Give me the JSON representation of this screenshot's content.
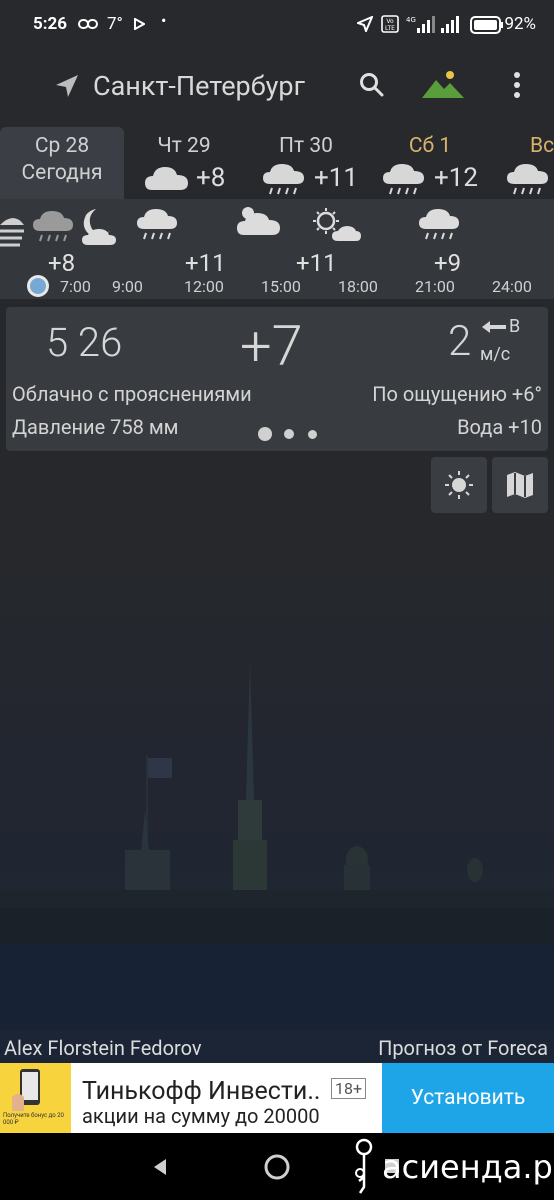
{
  "status_bar": {
    "time": "5:26",
    "temp": "7°",
    "battery": "92%"
  },
  "header": {
    "city": "Санкт-Петербург"
  },
  "days": [
    {
      "name": "Ср 28",
      "sub": "Сегодня",
      "temp": ""
    },
    {
      "name": "Чт 29",
      "sub": "",
      "temp": "+8"
    },
    {
      "name": "Пт 30",
      "sub": "",
      "temp": "+11"
    },
    {
      "name": "Сб 1",
      "sub": "",
      "temp": "+12"
    },
    {
      "name": "Вс",
      "sub": "",
      "temp": ""
    }
  ],
  "hourly": {
    "temps": [
      "+8",
      "+11",
      "+11",
      "+9"
    ],
    "times": [
      "7:00",
      "9:00",
      "12:00",
      "15:00",
      "18:00",
      "21:00",
      "24:00"
    ]
  },
  "current": {
    "time": "5 26",
    "temp": "+7",
    "wind_speed": "2",
    "wind_dir": "В",
    "wind_unit": "м/с",
    "condition": "Облачно с прояснениями",
    "feels_like": "По ощущению +6°",
    "pressure": "Давление 758 мм",
    "water": "Вода +10"
  },
  "credits": {
    "photo": "Alex Florstein Fedorov",
    "forecast": "Прогноз от Foreca"
  },
  "ad": {
    "title": "Тинькофф Инвести..",
    "age": "18+",
    "subtitle": "акции на сумму до 20000",
    "install": "Установить",
    "thumb_text": "Получите бонус до 20 000 ₽"
  },
  "watermark": "асиенда.ру",
  "colors": {
    "accent_saturday": "#d9b36a",
    "ad_button": "#1ea5e8",
    "background": "#27292d"
  }
}
